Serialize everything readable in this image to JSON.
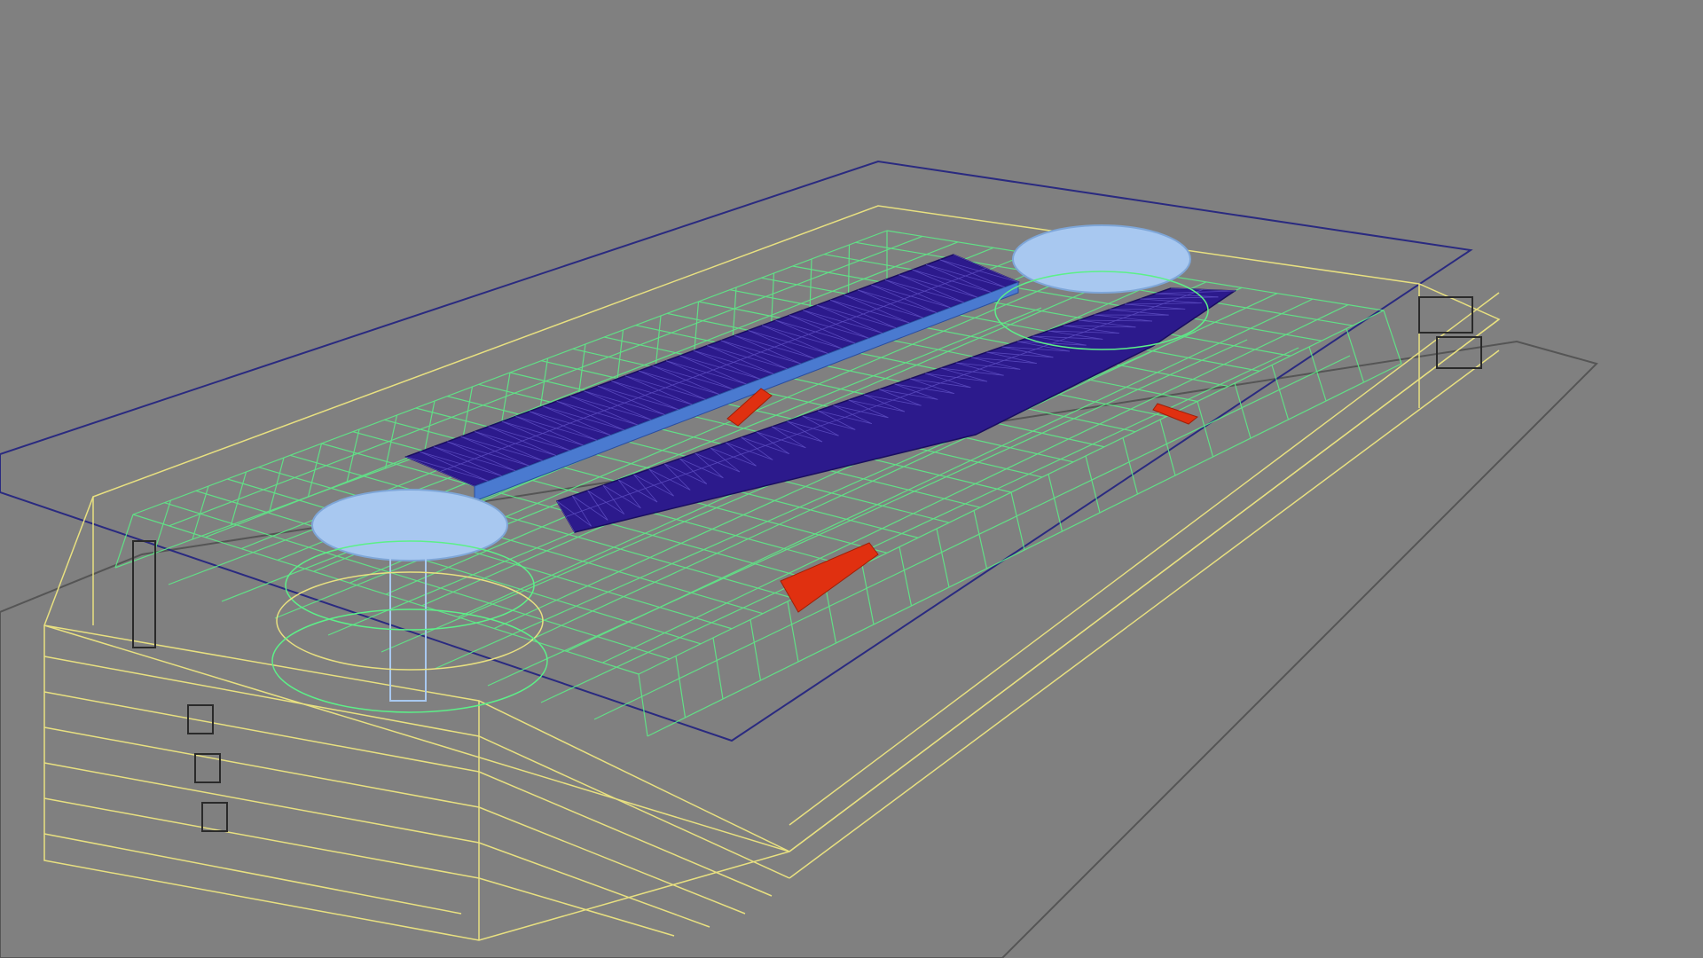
{
  "viewport": {
    "view": "perspective",
    "render_mode": "wireframe",
    "background_color": "#808080"
  },
  "scene": {
    "subject": "building-model",
    "colors": {
      "ground_plane": "#2a2a80",
      "base_plane": "#5a5a5a",
      "outer_wireframe": "#e8e080",
      "structure_wireframe": "#5cf088",
      "roof_mesh": "#2c1a8c",
      "roof_edge": "#4a7ad0",
      "dome": "#a8c8f0",
      "escalator": "#e03010",
      "window_frames": "#2a2a2a"
    }
  }
}
